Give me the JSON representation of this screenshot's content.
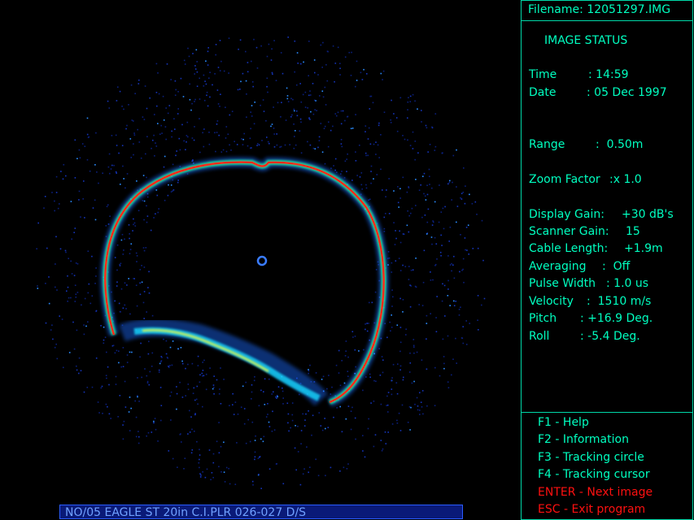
{
  "filename": {
    "label": "Filename:",
    "value": "12051297.IMG"
  },
  "status": {
    "title": "IMAGE STATUS",
    "rows": [
      {
        "label": "Time",
        "sep": ":",
        "value": "14:59"
      },
      {
        "label": "Date",
        "sep": ":",
        "value": "05 Dec 1997"
      },
      {
        "label": "Range",
        "sep": ":",
        "value": "0.50m"
      },
      {
        "label": "Zoom Factor",
        "sep": ":",
        "value": "x 1.0"
      },
      {
        "label": "Display Gain:",
        "sep": "",
        "value": "+30 dB's"
      },
      {
        "label": "Scanner Gain:",
        "sep": "",
        "value": "15"
      },
      {
        "label": "Cable Length:",
        "sep": "",
        "value": "+1.9m"
      },
      {
        "label": "Averaging",
        "sep": ":",
        "value": "Off"
      },
      {
        "label": "Pulse Width",
        "sep": ":",
        "value": "1.0 us"
      },
      {
        "label": "Velocity",
        "sep": ":",
        "value": "1510 m/s"
      },
      {
        "label": "Pitch",
        "sep": ":",
        "value": "+16.9  Deg."
      },
      {
        "label": "Roll",
        "sep": ":",
        "value": "-5.4  Deg."
      }
    ]
  },
  "keys": [
    {
      "text": "F1 - Help",
      "color": "#00ffc0"
    },
    {
      "text": "F2 - Information",
      "color": "#00ffc0"
    },
    {
      "text": "F3 - Tracking circle",
      "color": "#00ffc0"
    },
    {
      "text": "F4 - Tracking cursor",
      "color": "#00ffc0"
    },
    {
      "text": "ENTER - Next image",
      "color": "#ff1010"
    },
    {
      "text": "ESC - Exit program",
      "color": "#ff1010"
    }
  ],
  "caption": "NO/05 EAGLE ST 20in C.I.PLR 026-027 D/S"
}
